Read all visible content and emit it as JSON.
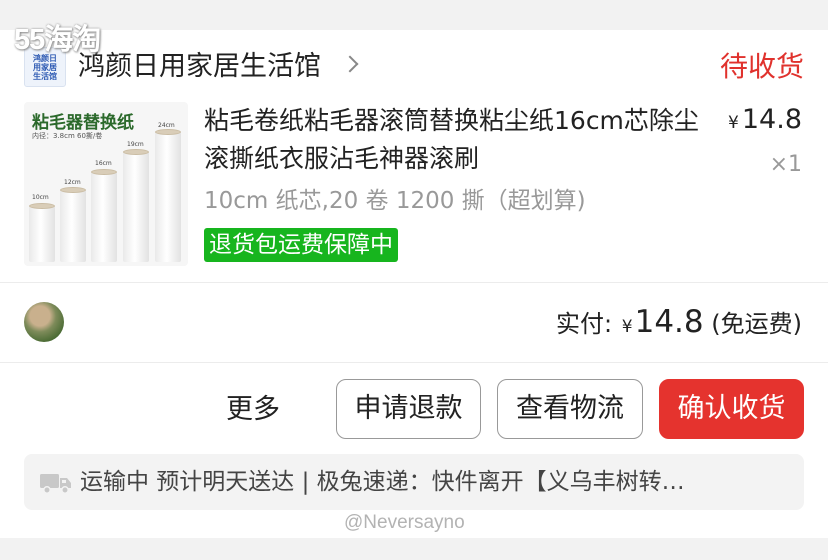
{
  "watermark_top": "55海淘",
  "store": {
    "logo_lines": [
      "鸿颜日",
      "用家居",
      "生活馆"
    ],
    "name": "鸿颜日用家居生活馆",
    "status": "待收货"
  },
  "product": {
    "image_title": "粘毛器替换纸",
    "image_subtitle": "内径：3.8cm  60撕/卷",
    "image_roll_labels": [
      "10cm",
      "12cm",
      "16cm",
      "19cm",
      "24cm"
    ],
    "title": "粘毛卷纸粘毛器滚筒替换粘尘纸16cm芯除尘滚撕纸衣服沾毛神器滚刷",
    "currency": "¥",
    "price": "14.8",
    "quantity": "×1",
    "sku": "10cm 纸芯,20 卷 1200 撕（超划算)",
    "badge": "退货包运费保障中"
  },
  "payment": {
    "label": "实付:",
    "currency": "¥",
    "amount": "14.8",
    "note": "(免运费)"
  },
  "actions": {
    "more": "更多",
    "refund": "申请退款",
    "logistics": "查看物流",
    "confirm": "确认收货"
  },
  "logistics": {
    "icon": "truck-icon",
    "text": "运输中  预计明天送达 | 极兔速递：快件离开【义乌丰树转…"
  },
  "watermark_bottom": "@Neversayno",
  "colors": {
    "status_red": "#e0322d",
    "button_red": "#e5332e",
    "badge_green": "#17b51e"
  }
}
